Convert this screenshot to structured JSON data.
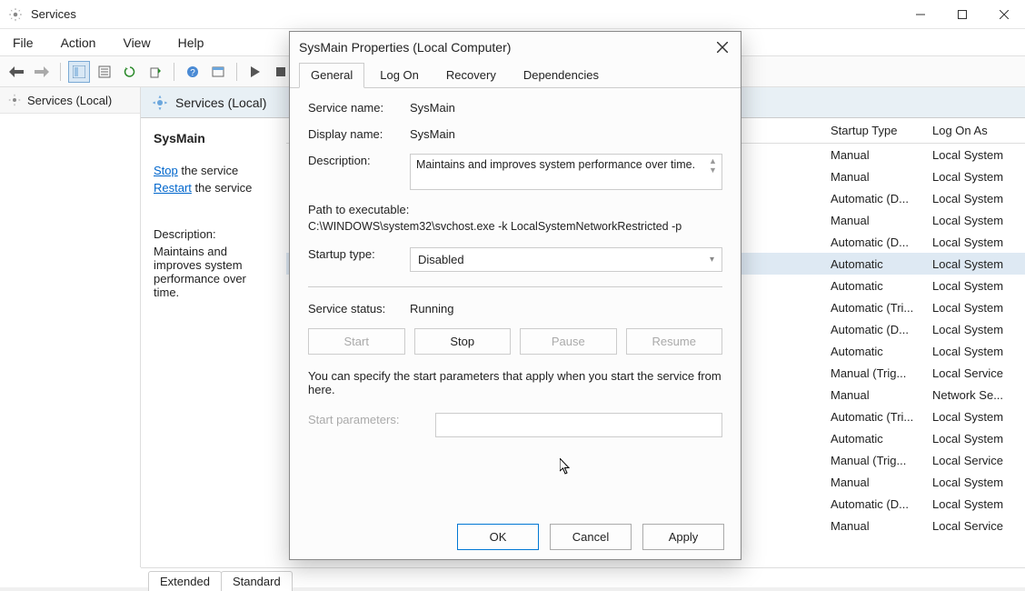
{
  "window": {
    "title": "Services",
    "menu": {
      "file": "File",
      "action": "Action",
      "view": "View",
      "help": "Help"
    }
  },
  "nav": {
    "root": "Services (Local)"
  },
  "right_header": {
    "title": "Services (Local)"
  },
  "detail": {
    "name": "SysMain",
    "stop_link": "Stop",
    "stop_rest": " the service",
    "restart_link": "Restart",
    "restart_rest": " the service",
    "desc_label": "Description:",
    "desc": "Maintains and improves system performance over time."
  },
  "columns": {
    "startup": "Startup Type",
    "logon": "Log On As"
  },
  "rows": [
    {
      "startup": "Manual",
      "logon": "Local System"
    },
    {
      "startup": "Manual",
      "logon": "Local System"
    },
    {
      "startup": "Automatic (D...",
      "logon": "Local System"
    },
    {
      "startup": "Manual",
      "logon": "Local System"
    },
    {
      "startup": "Automatic (D...",
      "logon": "Local System"
    },
    {
      "startup": "Automatic",
      "logon": "Local System",
      "selected": true
    },
    {
      "startup": "Automatic",
      "logon": "Local System"
    },
    {
      "startup": "Automatic (Tri...",
      "logon": "Local System"
    },
    {
      "startup": "Automatic (D...",
      "logon": "Local System"
    },
    {
      "startup": "Automatic",
      "logon": "Local System"
    },
    {
      "startup": "Manual (Trig...",
      "logon": "Local Service"
    },
    {
      "startup": "Manual",
      "logon": "Network Se..."
    },
    {
      "startup": "Automatic (Tri...",
      "logon": "Local System"
    },
    {
      "startup": "Automatic",
      "logon": "Local System"
    },
    {
      "startup": "Manual (Trig...",
      "logon": "Local Service"
    },
    {
      "startup": "Manual",
      "logon": "Local System"
    },
    {
      "startup": "Automatic (D...",
      "logon": "Local System"
    },
    {
      "startup": "Manual",
      "logon": "Local Service"
    }
  ],
  "bottom_tabs": {
    "extended": "Extended",
    "standard": "Standard"
  },
  "dialog": {
    "title": "SysMain Properties (Local Computer)",
    "tabs": {
      "general": "General",
      "logon": "Log On",
      "recovery": "Recovery",
      "dependencies": "Dependencies"
    },
    "labels": {
      "service_name": "Service name:",
      "display_name": "Display name:",
      "description": "Description:",
      "path_label": "Path to executable:",
      "startup_type": "Startup type:",
      "service_status": "Service status:",
      "start_params_help": "You can specify the start parameters that apply when you start the service from here.",
      "start_params": "Start parameters:"
    },
    "values": {
      "service_name": "SysMain",
      "display_name": "SysMain",
      "description": "Maintains and improves system performance over time.",
      "path": "C:\\WINDOWS\\system32\\svchost.exe -k LocalSystemNetworkRestricted -p",
      "startup_type": "Disabled",
      "service_status": "Running",
      "start_params": ""
    },
    "buttons": {
      "start": "Start",
      "stop": "Stop",
      "pause": "Pause",
      "resume": "Resume",
      "ok": "OK",
      "cancel": "Cancel",
      "apply": "Apply"
    }
  }
}
